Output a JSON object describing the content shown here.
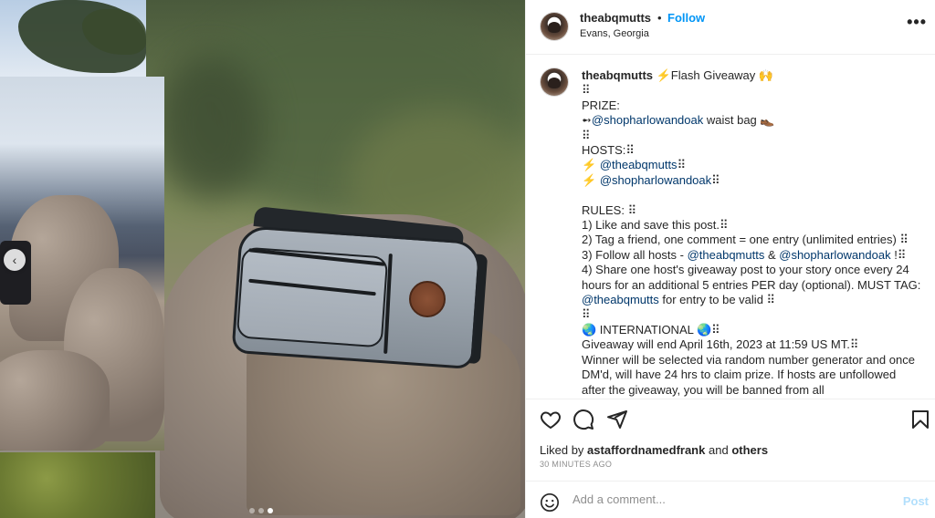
{
  "post": {
    "username": "theabqmutts",
    "separator": "•",
    "follow_label": "Follow",
    "location": "Evans, Georgia",
    "more_icon": "more-horizontal-icon"
  },
  "caption": {
    "username": "theabqmutts",
    "lines": [
      "⚡Flash Giveaway 🙌",
      "⠿",
      "PRIZE:",
      "➻@shopharlowandoak waist bag 👞",
      "⠿",
      "HOSTS:⠿",
      "⚡ @theabqmutts⠿",
      "⚡ @shopharlowandoak⠿",
      "",
      "RULES: ⠿",
      "1) Like and save this post.⠿",
      "2) Tag a friend, one comment = one entry (unlimited entries) ⠿",
      "3) Follow all hosts - @theabqmutts & @shopharlowandoak !⠿",
      "4) Share one host's giveaway post to your story once every 24 hours for an additional 5 entries PER day (optional). MUST TAG: @theabqmutts for entry to be valid ⠿",
      "⠿",
      "🌏 INTERNATIONAL 🌏⠿",
      "Giveaway will end April 16th, 2023 at 11:59 US MT.⠿",
      "Winner will be selected via random number generator and once DM'd, will have 24 hrs to claim prize. If hosts are unfollowed after the giveaway, you will be banned from all"
    ]
  },
  "actions": {
    "like_icon": "heart-icon",
    "comment_icon": "comment-icon",
    "share_icon": "send-icon",
    "save_icon": "bookmark-icon"
  },
  "likes": {
    "prefix": "Liked by",
    "user": "astaffordnamedfrank",
    "middle": "and",
    "others": "others"
  },
  "timestamp": "30 MINUTES AGO",
  "comment": {
    "placeholder": "Add a comment...",
    "post_label": "Post",
    "emoji_icon": "emoji-icon"
  },
  "carousel": {
    "prev_icon": "chevron-left-icon",
    "dot_count": 3,
    "active_index": 2
  },
  "colors": {
    "link": "#0095f6",
    "mention": "#00376b",
    "text": "#262626",
    "muted": "#8e8e8e",
    "post_disabled": "#b2dffc"
  }
}
